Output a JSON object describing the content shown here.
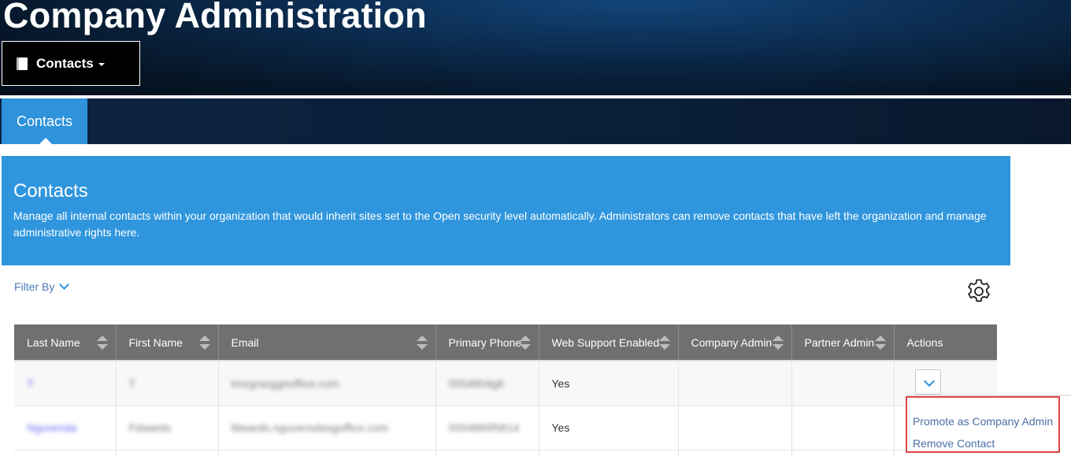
{
  "header": {
    "title": "Company Administration",
    "dropdown_label": "Contacts"
  },
  "nav": {
    "tabs": [
      {
        "label": "Contacts",
        "active": true
      }
    ]
  },
  "banner": {
    "title": "Contacts",
    "description": "Manage all internal contacts within your organization that would inherit sites set to the Open security level automatically. Administrators can remove contacts that have left the organization and manage administrative rights here."
  },
  "toolbar": {
    "filter_label": "Filter By",
    "settings_icon": "gear-icon"
  },
  "table": {
    "columns": [
      "Last Name",
      "First Name",
      "Email",
      "Primary Phone",
      "Web Support Enabled",
      "Company Admin",
      "Partner Admin",
      "Actions"
    ],
    "rows": [
      {
        "last_name": "T",
        "first_name": "T",
        "email": "tmzgrazggnoffice.com",
        "phone": "5554804g6",
        "web_support": "Yes",
        "company_admin": "",
        "partner_admin": ""
      },
      {
        "last_name": "Nguvenda",
        "first_name": "Fdwards",
        "email": "fdwards.nguvensdasgoffice.com",
        "phone": "5554865f5814",
        "web_support": "Yes",
        "company_admin": "",
        "partner_admin": ""
      }
    ]
  },
  "actions_menu": {
    "items": [
      "Promote as Company Admin",
      "Remove Contact"
    ]
  },
  "colors": {
    "accent_blue": "#2f96de",
    "header_gray": "#707070",
    "highlight_red": "#e04444",
    "link_blue": "#4a6fa5"
  }
}
